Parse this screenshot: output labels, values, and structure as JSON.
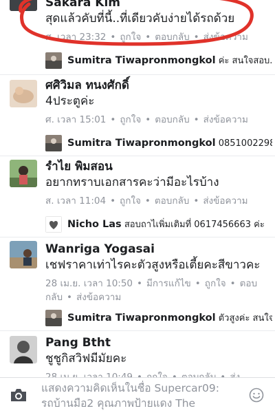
{
  "comments": [
    {
      "name": "Sakara Kim",
      "text": "สุดแล้วคับที่นี้..ที่เดียวคับง่ายได้รถด้วย",
      "time": "ศ. เวลา 23:32",
      "actions": [
        "ถูกใจ",
        "ตอบกลับ",
        "ส่งข้อความ"
      ],
      "reply": {
        "name": "Sumitra Tiwapronmongkol",
        "text": "ค่ะ สนใจสอบ..."
      }
    },
    {
      "name": "ศศิวิมล ทนงศักดิ์",
      "text": "4ประตูค่ะ",
      "time": "ศ. เวลา 15:01",
      "actions": [
        "ถูกใจ",
        "ตอบกลับ",
        "ส่งข้อความ"
      ],
      "reply": {
        "name": "Sumitra Tiwapronmongkol",
        "text": "0851002298..."
      }
    },
    {
      "name": "รำไย พิมสอน",
      "text": "อยากทราบเอกสารคะว่ามีอะไรบ้าง",
      "time": "ส. เวลา 11:04",
      "actions": [
        "ถูกใจ",
        "ตอบกลับ",
        "ส่งข้อความ"
      ],
      "reply": {
        "name": "Nicho Las",
        "text": "สอบถาไเพิ่มเติมที่ 0617456663 ค่ะ"
      }
    },
    {
      "name": "Wanriga Yogasai",
      "text": "เชฟราคาเท่าไรคะตัวสูงหรือเตี้ยคะสีขาวคะ",
      "time": "28 เม.ย. เวลา 10:50",
      "edited": "มีการแก้ไข",
      "actions": [
        "ถูกใจ",
        "ตอบ",
        "กลับ",
        "ส่งข้อความ"
      ],
      "reply": {
        "name": "Sumitra Tiwapronmongkol",
        "text": "ตัวสูงค่ะ สนใจ..."
      }
    },
    {
      "name": "Pang Btht",
      "text": "ชูชูกิสวิฟมีมัยคะ",
      "time": "28 เม.ย. เวลา 10:49",
      "actions": [
        "ถูกใจ",
        "ตอบกลับ",
        "ส่ง"
      ]
    }
  ],
  "composer": {
    "placeholder_line1": "แสดงความคิดเห็นในชื่อ Supercar09:",
    "placeholder_line2": "รถบ้านมือ2 คุณภาพป้ายแดง The"
  },
  "colors": {
    "marker": "#e0322a",
    "meta": "#90949c",
    "text": "#1c1e21"
  },
  "icons": [
    "camera-icon",
    "smiley-icon"
  ]
}
